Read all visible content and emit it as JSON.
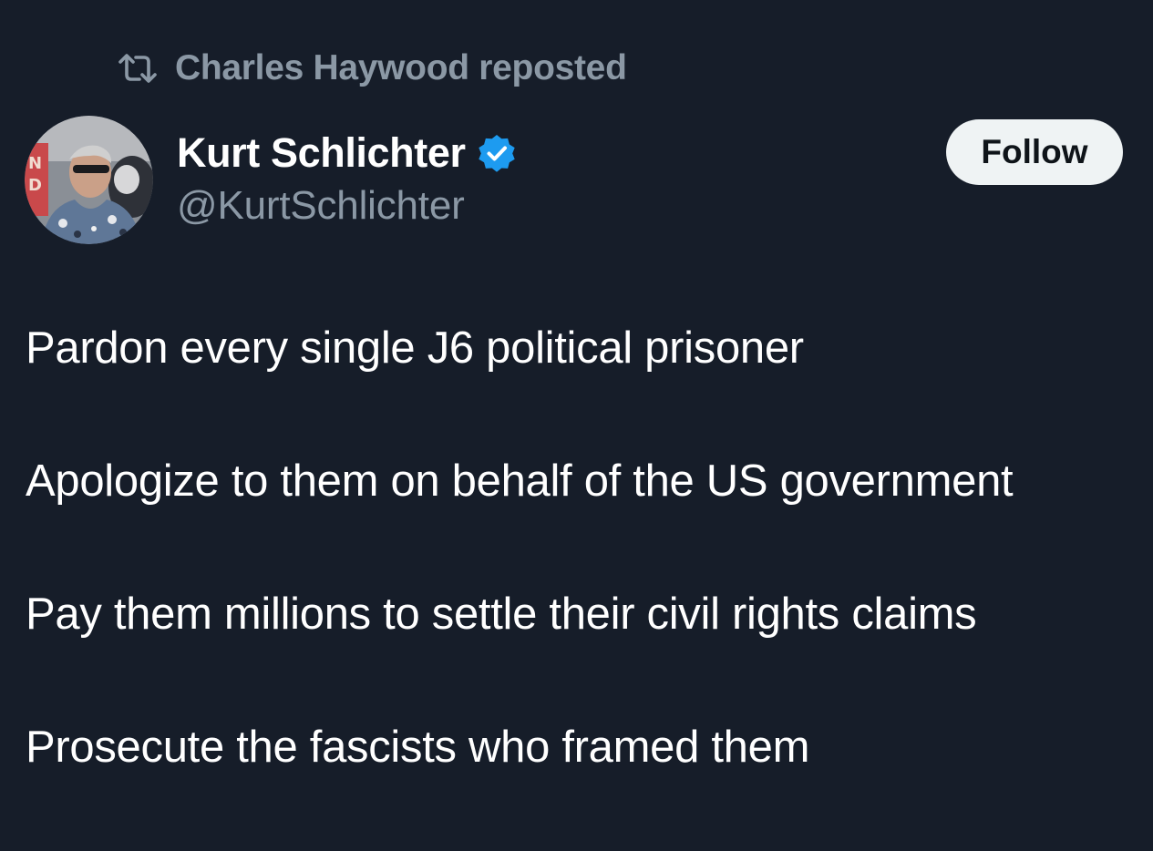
{
  "repost": {
    "text": "Charles Haywood reposted",
    "icon": "repost-icon"
  },
  "author": {
    "display_name": "Kurt Schlichter",
    "handle": "@KurtSchlichter",
    "verified": true,
    "verified_icon": "verified-badge-icon",
    "verified_color": "#1d9bf0"
  },
  "follow_button": {
    "label": "Follow"
  },
  "tweet": {
    "lines": [
      "Pardon every single J6 political prisoner",
      "Apologize to them on behalf of the US government",
      "Pay them millions to settle their civil rights claims",
      "Prosecute the fascists who framed them"
    ]
  },
  "colors": {
    "background": "#161d29",
    "secondary_text": "#8b98a5",
    "primary_text": "#ffffff",
    "button_bg": "#eff3f4"
  }
}
